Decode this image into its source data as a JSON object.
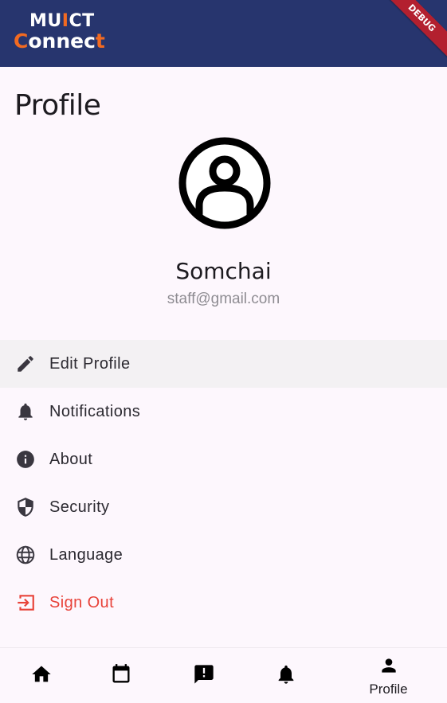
{
  "app": {
    "logo_line1_a": "MU",
    "logo_line1_b": "I",
    "logo_line1_c": "CT",
    "logo_line2_a": "C",
    "logo_line2_b": "onnec",
    "logo_line2_c": "t",
    "debug_banner": "DEBUG",
    "colors": {
      "appbar": "#27356e",
      "accent": "#f26a21",
      "danger": "#e8433a",
      "background": "#fdf7fd"
    }
  },
  "page": {
    "title": "Profile"
  },
  "user": {
    "avatar_icon": "account-circle-icon",
    "name": "Somchai",
    "email": "staff@gmail.com"
  },
  "menu": {
    "items": [
      {
        "label": "Edit Profile",
        "icon": "pencil-icon",
        "selected": true
      },
      {
        "label": "Notifications",
        "icon": "bell-icon"
      },
      {
        "label": "About",
        "icon": "info-icon"
      },
      {
        "label": "Security",
        "icon": "shield-icon"
      },
      {
        "label": "Language",
        "icon": "globe-icon"
      },
      {
        "label": "Sign Out",
        "icon": "logout-icon",
        "danger": true
      }
    ]
  },
  "bottom_nav": {
    "items": [
      {
        "icon": "home-icon",
        "label": ""
      },
      {
        "icon": "calendar-icon",
        "label": ""
      },
      {
        "icon": "report-icon",
        "label": ""
      },
      {
        "icon": "bell-icon",
        "label": ""
      },
      {
        "icon": "person-icon",
        "label": "Profile",
        "active": true
      }
    ]
  }
}
